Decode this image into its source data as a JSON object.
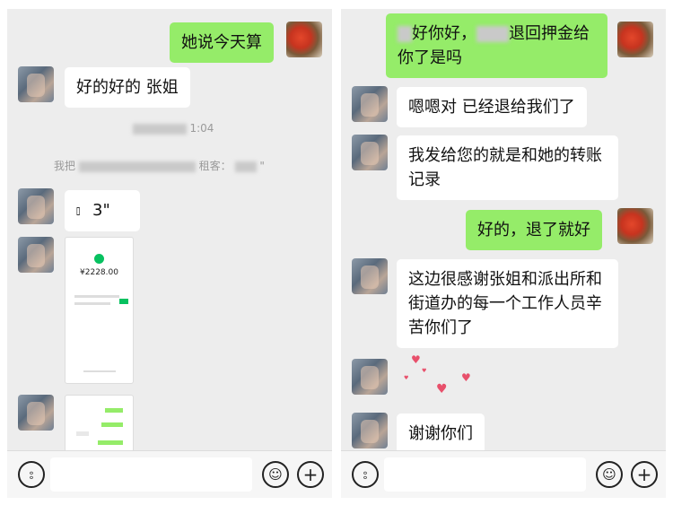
{
  "left_panel": {
    "messages": {
      "out1": "她说今天算",
      "in1": "好的好的 张姐",
      "voice": "3\"",
      "receipt_amount": "¥2228.00"
    },
    "system": {
      "time_tail": "1:04",
      "note_head": "我把",
      "note_mid": "租客：",
      "note_tail": "\""
    }
  },
  "right_panel": {
    "messages": {
      "out1_a": "好你好，",
      "out1_b": "退回押金给",
      "out1_c": "你了是吗",
      "in1": "嗯嗯对 已经退给我们了",
      "in2": "我发给您的就是和她的转账记录",
      "out2": "好的，退了就好",
      "in3": "这边很感谢张姐和派出所和街道办的每一个工作人员辛苦你们了",
      "in4": "谢谢你们"
    }
  },
  "icons": {
    "voice_mode": "voice-mode-icon",
    "emoji": "emoji-icon",
    "more": "plus-icon"
  },
  "colors": {
    "chat_bg": "#ededed",
    "outgoing_bubble": "#95ec69",
    "incoming_bubble": "#ffffff"
  }
}
